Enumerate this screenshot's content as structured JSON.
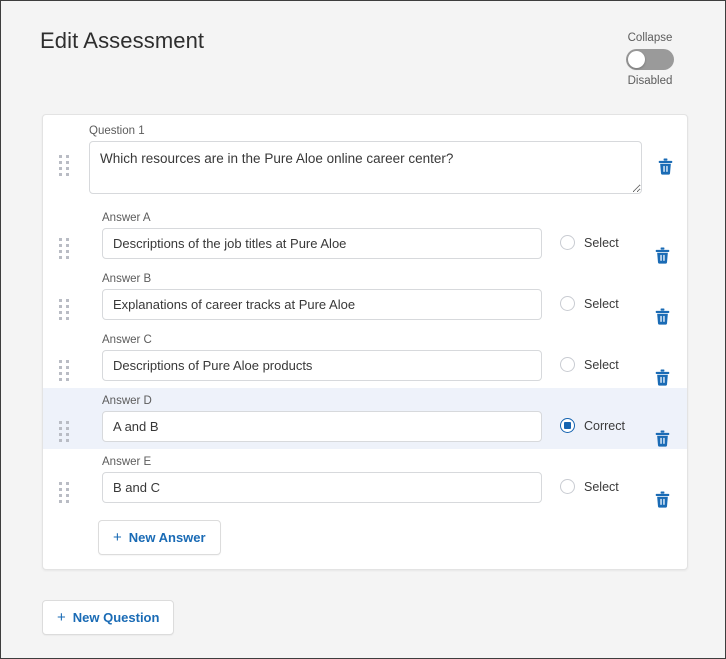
{
  "header": {
    "title": "Edit Assessment",
    "collapse_label": "Collapse",
    "collapse_state": "Disabled",
    "toggle_name": "collapse-toggle"
  },
  "question": {
    "label": "Question 1",
    "text": "Which resources are in the Pure Aloe online career center?",
    "delete_icon": "trash-icon",
    "drag_icon": "drag-handle-icon"
  },
  "answers": [
    {
      "label": "Answer A",
      "text": "Descriptions of the job titles at Pure Aloe",
      "choice": "Select",
      "selected": false
    },
    {
      "label": "Answer B",
      "text": "Explanations of career tracks at Pure Aloe",
      "choice": "Select",
      "selected": false
    },
    {
      "label": "Answer C",
      "text": "Descriptions of Pure Aloe products",
      "choice": "Select",
      "selected": false
    },
    {
      "label": "Answer D",
      "text": "A and B",
      "choice": "Correct",
      "selected": true
    },
    {
      "label": "Answer E",
      "text": "B and C",
      "choice": "Select",
      "selected": false
    }
  ],
  "buttons": {
    "new_answer": "New Answer",
    "new_question": "New Question",
    "plus": "+"
  },
  "colors": {
    "accent": "#1a6bb5",
    "selected_row_bg": "#eef2fa",
    "page_bg": "#f4f4f4",
    "toggle_track": "#9a9a9a"
  }
}
